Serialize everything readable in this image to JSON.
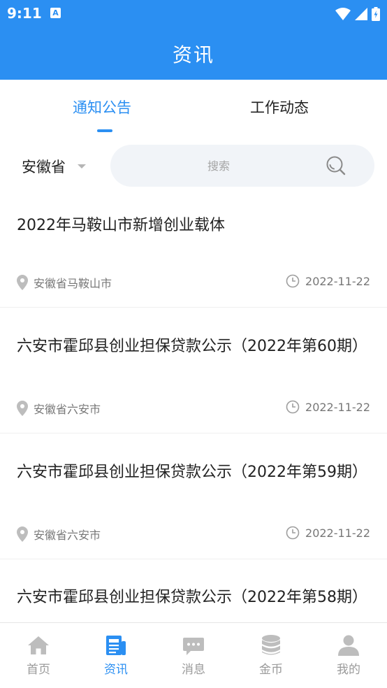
{
  "status_bar": {
    "time": "9:11",
    "notification_badge": "A"
  },
  "app_bar": {
    "title": "资讯"
  },
  "tabs": [
    {
      "label": "通知公告",
      "active": true
    },
    {
      "label": "工作动态",
      "active": false
    }
  ],
  "filter": {
    "province": "安徽省",
    "search_placeholder": "搜索"
  },
  "news": [
    {
      "title": "2022年马鞍山市新增创业载体",
      "location": "安徽省马鞍山市",
      "date": "2022-11-22"
    },
    {
      "title": "六安市霍邱县创业担保贷款公示（2022年第60期）",
      "location": "安徽省六安市",
      "date": "2022-11-22"
    },
    {
      "title": "六安市霍邱县创业担保贷款公示（2022年第59期）",
      "location": "安徽省六安市",
      "date": "2022-11-22"
    },
    {
      "title": "六安市霍邱县创业担保贷款公示（2022年第58期）",
      "location": "",
      "date": ""
    }
  ],
  "bottom_nav": [
    {
      "label": "首页",
      "icon": "home-icon",
      "active": false
    },
    {
      "label": "资讯",
      "icon": "news-icon",
      "active": true
    },
    {
      "label": "消息",
      "icon": "message-icon",
      "active": false
    },
    {
      "label": "金币",
      "icon": "coins-icon",
      "active": false
    },
    {
      "label": "我的",
      "icon": "profile-icon",
      "active": false
    }
  ],
  "colors": {
    "primary": "#2b8ff2",
    "inactive": "#9a9a9a",
    "nav_icon_inactive": "#bdbdbd"
  }
}
